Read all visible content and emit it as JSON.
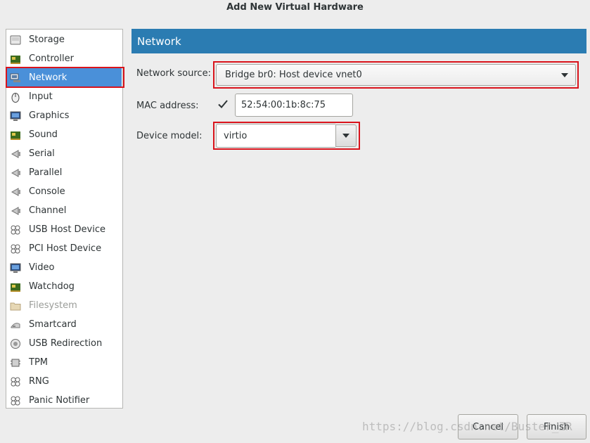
{
  "window": {
    "title": "Add New Virtual Hardware"
  },
  "sidebar": {
    "selected_index": 2,
    "items": [
      {
        "label": "Storage",
        "icon": "disk-icon"
      },
      {
        "label": "Controller",
        "icon": "chip-icon"
      },
      {
        "label": "Network",
        "icon": "network-icon"
      },
      {
        "label": "Input",
        "icon": "mouse-icon"
      },
      {
        "label": "Graphics",
        "icon": "monitor-icon"
      },
      {
        "label": "Sound",
        "icon": "sound-card-icon"
      },
      {
        "label": "Serial",
        "icon": "serial-port-icon"
      },
      {
        "label": "Parallel",
        "icon": "parallel-port-icon"
      },
      {
        "label": "Console",
        "icon": "console-port-icon"
      },
      {
        "label": "Channel",
        "icon": "channel-port-icon"
      },
      {
        "label": "USB Host Device",
        "icon": "usb-device-icon"
      },
      {
        "label": "PCI Host Device",
        "icon": "pci-device-icon"
      },
      {
        "label": "Video",
        "icon": "video-monitor-icon"
      },
      {
        "label": "Watchdog",
        "icon": "watchdog-chip-icon"
      },
      {
        "label": "Filesystem",
        "icon": "folder-icon",
        "disabled": true
      },
      {
        "label": "Smartcard",
        "icon": "smartcard-icon"
      },
      {
        "label": "USB Redirection",
        "icon": "usb-redirect-icon"
      },
      {
        "label": "TPM",
        "icon": "tpm-chip-icon"
      },
      {
        "label": "RNG",
        "icon": "rng-device-icon"
      },
      {
        "label": "Panic Notifier",
        "icon": "panic-notifier-icon"
      }
    ]
  },
  "main": {
    "header": "Network",
    "network_source": {
      "label": "Network source:",
      "value": "Bridge br0: Host device vnet0"
    },
    "mac_address": {
      "label": "MAC address:",
      "checked": true,
      "value": "52:54:00:1b:8c:75"
    },
    "device_model": {
      "label": "Device model:",
      "value": "virtio"
    }
  },
  "footer": {
    "cancel_label": "Cancel",
    "finish_label": "Finish"
  },
  "watermark": "https://blog.csdn.net/Buster_ZR",
  "colors": {
    "selection": "#4a90d9",
    "header": "#2b7cb2",
    "highlight": "#d9141c"
  }
}
